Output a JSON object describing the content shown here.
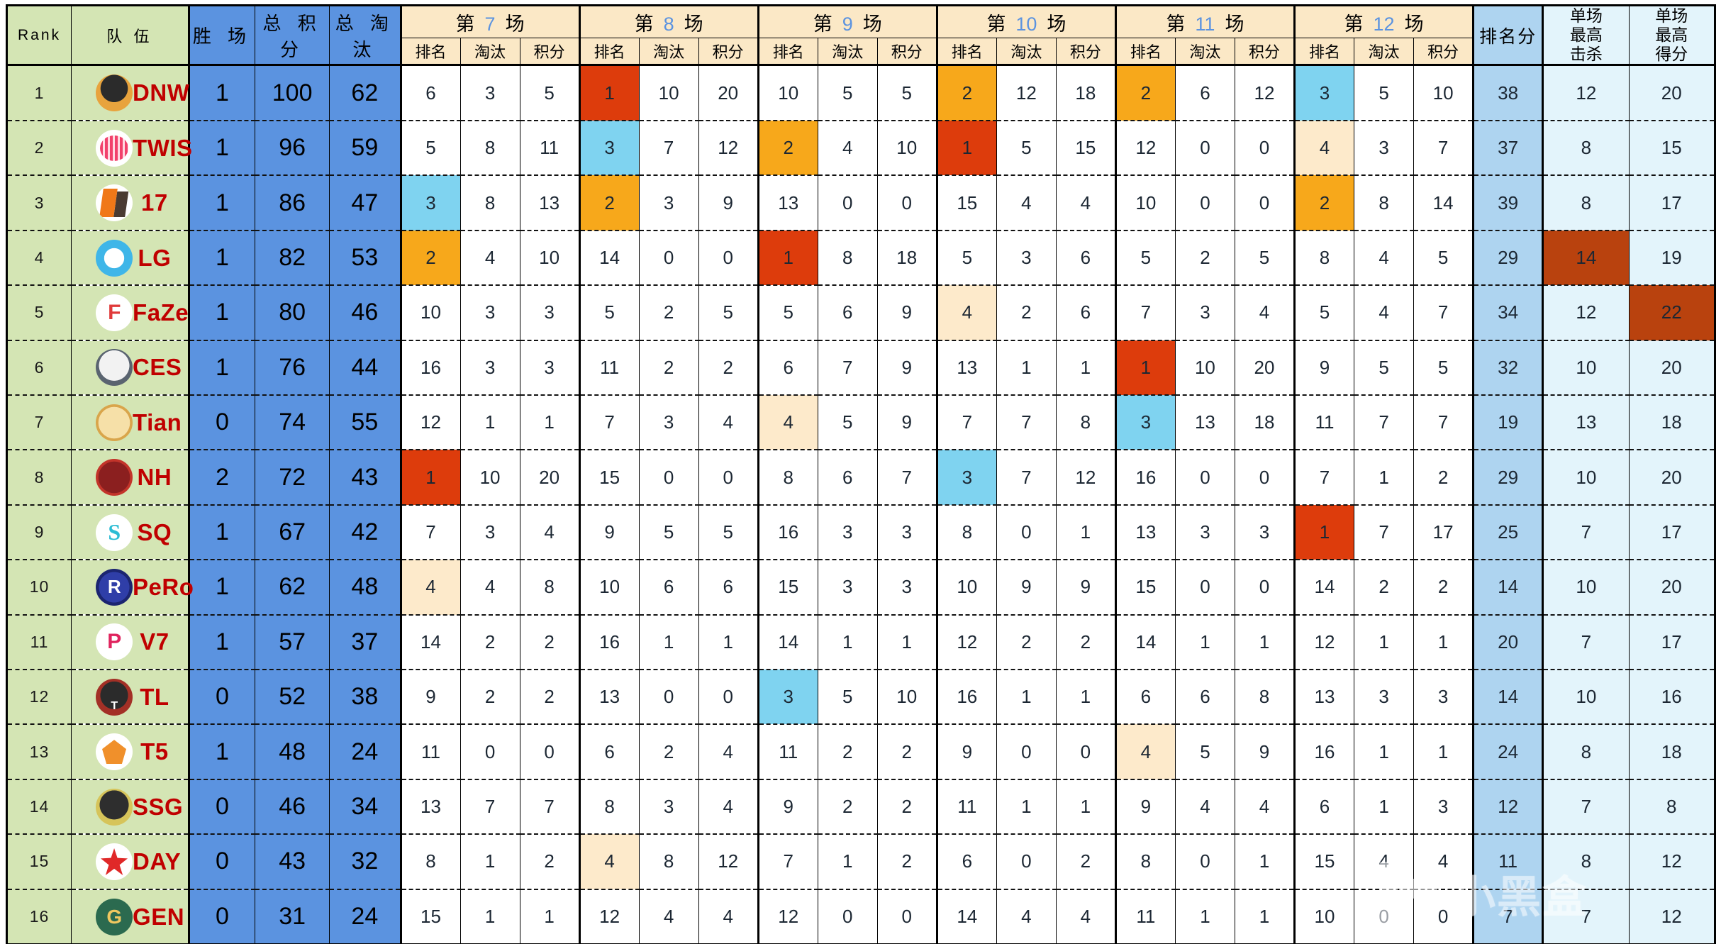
{
  "header": {
    "rank_label": "Rank",
    "team_label": "队 伍",
    "wins_label": "胜 场",
    "total_points_label": "总 积 分",
    "total_elims_label": "总 淘 汰",
    "match_prefix": "第",
    "match_suffix": "场",
    "match_numbers": [
      "7",
      "8",
      "9",
      "10",
      "11",
      "12"
    ],
    "sub_labels": {
      "place": "排名",
      "elims": "淘汰",
      "points": "积分"
    },
    "rank_points_label": "排名分",
    "best_kills_label": "单场\n最高\n击杀",
    "best_kills_lines": [
      "单场",
      "最高",
      "击杀"
    ],
    "best_score_label": "单场\n最高\n得分",
    "best_score_lines": [
      "单场",
      "最高",
      "得分"
    ]
  },
  "colors": {
    "header_green": "#d4e5b4",
    "header_blue": "#5b93e0",
    "header_cream": "#fbe8c6",
    "rank_points_blue": "#aed4f0",
    "best_light_blue": "#e3f4fb",
    "place1_red": "#dd3c0c",
    "place2_orange": "#f7a81b",
    "place3_cyan": "#7fd3f0",
    "place4_cream": "#fdeacb",
    "highlight_dark_red": "#b9420e",
    "team_name_red": "#c00000",
    "match_number_blue": "#5b93e0"
  },
  "watermark": {
    "text": "小黑盒"
  },
  "rows": [
    {
      "rank": "1",
      "team": "DNW",
      "logo": "lg-dnw",
      "wins": "1",
      "total_points": "100",
      "total_elims": "62",
      "matches": [
        {
          "place": "6",
          "elims": "3",
          "points": "5"
        },
        {
          "place": "1",
          "elims": "10",
          "points": "20",
          "hl": "hl-1"
        },
        {
          "place": "10",
          "elims": "5",
          "points": "5"
        },
        {
          "place": "2",
          "elims": "12",
          "points": "18",
          "hl": "hl-2"
        },
        {
          "place": "2",
          "elims": "6",
          "points": "12",
          "hl": "hl-2"
        },
        {
          "place": "3",
          "elims": "5",
          "points": "10",
          "hl": "hl-3"
        }
      ],
      "rank_points": "38",
      "best_kills": "12",
      "best_score": "20"
    },
    {
      "rank": "2",
      "team": "TWIS",
      "logo": "lg-twis",
      "wins": "1",
      "total_points": "96",
      "total_elims": "59",
      "matches": [
        {
          "place": "5",
          "elims": "8",
          "points": "11"
        },
        {
          "place": "3",
          "elims": "7",
          "points": "12",
          "hl": "hl-3"
        },
        {
          "place": "2",
          "elims": "4",
          "points": "10",
          "hl": "hl-2"
        },
        {
          "place": "1",
          "elims": "5",
          "points": "15",
          "hl": "hl-1"
        },
        {
          "place": "12",
          "elims": "0",
          "points": "0"
        },
        {
          "place": "4",
          "elims": "3",
          "points": "7",
          "hl": "hl-4"
        }
      ],
      "rank_points": "37",
      "best_kills": "8",
      "best_score": "15"
    },
    {
      "rank": "3",
      "team": "17",
      "logo": "lg-17",
      "wins": "1",
      "total_points": "86",
      "total_elims": "47",
      "matches": [
        {
          "place": "3",
          "elims": "8",
          "points": "13",
          "hl": "hl-3"
        },
        {
          "place": "2",
          "elims": "3",
          "points": "9",
          "hl": "hl-2"
        },
        {
          "place": "13",
          "elims": "0",
          "points": "0"
        },
        {
          "place": "15",
          "elims": "4",
          "points": "4"
        },
        {
          "place": "10",
          "elims": "0",
          "points": "0"
        },
        {
          "place": "2",
          "elims": "8",
          "points": "14",
          "hl": "hl-2"
        }
      ],
      "rank_points": "39",
      "best_kills": "8",
      "best_score": "17"
    },
    {
      "rank": "4",
      "team": "LG",
      "logo": "lg-lg",
      "wins": "1",
      "total_points": "82",
      "total_elims": "53",
      "matches": [
        {
          "place": "2",
          "elims": "4",
          "points": "10",
          "hl": "hl-2"
        },
        {
          "place": "14",
          "elims": "0",
          "points": "0"
        },
        {
          "place": "1",
          "elims": "8",
          "points": "18",
          "hl": "hl-1"
        },
        {
          "place": "5",
          "elims": "3",
          "points": "6"
        },
        {
          "place": "5",
          "elims": "2",
          "points": "5"
        },
        {
          "place": "8",
          "elims": "4",
          "points": "5"
        }
      ],
      "rank_points": "29",
      "best_kills": "14",
      "best_score": "19",
      "best_kills_hl": "hl-dark"
    },
    {
      "rank": "5",
      "team": "FaZe",
      "logo": "lg-faze",
      "wins": "1",
      "total_points": "80",
      "total_elims": "46",
      "matches": [
        {
          "place": "10",
          "elims": "3",
          "points": "3"
        },
        {
          "place": "5",
          "elims": "2",
          "points": "5"
        },
        {
          "place": "5",
          "elims": "6",
          "points": "9"
        },
        {
          "place": "4",
          "elims": "2",
          "points": "6",
          "hl": "hl-4"
        },
        {
          "place": "7",
          "elims": "3",
          "points": "4"
        },
        {
          "place": "5",
          "elims": "4",
          "points": "7"
        }
      ],
      "rank_points": "34",
      "best_kills": "12",
      "best_score": "22",
      "best_score_hl": "hl-dark"
    },
    {
      "rank": "6",
      "team": "CES",
      "logo": "lg-ces",
      "wins": "1",
      "total_points": "76",
      "total_elims": "44",
      "matches": [
        {
          "place": "16",
          "elims": "3",
          "points": "3"
        },
        {
          "place": "11",
          "elims": "2",
          "points": "2"
        },
        {
          "place": "6",
          "elims": "7",
          "points": "9"
        },
        {
          "place": "13",
          "elims": "1",
          "points": "1"
        },
        {
          "place": "1",
          "elims": "10",
          "points": "20",
          "hl": "hl-1"
        },
        {
          "place": "9",
          "elims": "5",
          "points": "5"
        }
      ],
      "rank_points": "32",
      "best_kills": "10",
      "best_score": "20"
    },
    {
      "rank": "7",
      "team": "Tian",
      "logo": "lg-tian",
      "wins": "0",
      "total_points": "74",
      "total_elims": "55",
      "matches": [
        {
          "place": "12",
          "elims": "1",
          "points": "1"
        },
        {
          "place": "7",
          "elims": "3",
          "points": "4"
        },
        {
          "place": "4",
          "elims": "5",
          "points": "9",
          "hl": "hl-4"
        },
        {
          "place": "7",
          "elims": "7",
          "points": "8"
        },
        {
          "place": "3",
          "elims": "13",
          "points": "18",
          "hl": "hl-3"
        },
        {
          "place": "11",
          "elims": "7",
          "points": "7"
        }
      ],
      "rank_points": "19",
      "best_kills": "13",
      "best_score": "18"
    },
    {
      "rank": "8",
      "team": "NH",
      "logo": "lg-nh",
      "wins": "2",
      "total_points": "72",
      "total_elims": "43",
      "matches": [
        {
          "place": "1",
          "elims": "10",
          "points": "20",
          "hl": "hl-1"
        },
        {
          "place": "15",
          "elims": "0",
          "points": "0"
        },
        {
          "place": "8",
          "elims": "6",
          "points": "7"
        },
        {
          "place": "3",
          "elims": "7",
          "points": "12",
          "hl": "hl-3"
        },
        {
          "place": "16",
          "elims": "0",
          "points": "0"
        },
        {
          "place": "7",
          "elims": "1",
          "points": "2"
        }
      ],
      "rank_points": "29",
      "best_kills": "10",
      "best_score": "20"
    },
    {
      "rank": "9",
      "team": "SQ",
      "logo": "lg-sq",
      "wins": "1",
      "total_points": "67",
      "total_elims": "42",
      "matches": [
        {
          "place": "7",
          "elims": "3",
          "points": "4"
        },
        {
          "place": "9",
          "elims": "5",
          "points": "5"
        },
        {
          "place": "16",
          "elims": "3",
          "points": "3"
        },
        {
          "place": "8",
          "elims": "0",
          "points": "1"
        },
        {
          "place": "13",
          "elims": "3",
          "points": "3"
        },
        {
          "place": "1",
          "elims": "7",
          "points": "17",
          "hl": "hl-1"
        }
      ],
      "rank_points": "25",
      "best_kills": "7",
      "best_score": "17"
    },
    {
      "rank": "10",
      "team": "PeRo",
      "logo": "lg-pero",
      "wins": "1",
      "total_points": "62",
      "total_elims": "48",
      "matches": [
        {
          "place": "4",
          "elims": "4",
          "points": "8",
          "hl": "hl-4"
        },
        {
          "place": "10",
          "elims": "6",
          "points": "6"
        },
        {
          "place": "15",
          "elims": "3",
          "points": "3"
        },
        {
          "place": "10",
          "elims": "9",
          "points": "9"
        },
        {
          "place": "15",
          "elims": "0",
          "points": "0"
        },
        {
          "place": "14",
          "elims": "2",
          "points": "2"
        }
      ],
      "rank_points": "14",
      "best_kills": "10",
      "best_score": "20"
    },
    {
      "rank": "11",
      "team": "V7",
      "logo": "lg-v7",
      "wins": "1",
      "total_points": "57",
      "total_elims": "37",
      "matches": [
        {
          "place": "14",
          "elims": "2",
          "points": "2"
        },
        {
          "place": "16",
          "elims": "1",
          "points": "1"
        },
        {
          "place": "14",
          "elims": "1",
          "points": "1"
        },
        {
          "place": "12",
          "elims": "2",
          "points": "2"
        },
        {
          "place": "14",
          "elims": "1",
          "points": "1"
        },
        {
          "place": "12",
          "elims": "1",
          "points": "1"
        }
      ],
      "rank_points": "20",
      "best_kills": "7",
      "best_score": "17"
    },
    {
      "rank": "12",
      "team": "TL",
      "logo": "lg-tl",
      "wins": "0",
      "total_points": "52",
      "total_elims": "38",
      "matches": [
        {
          "place": "9",
          "elims": "2",
          "points": "2"
        },
        {
          "place": "13",
          "elims": "0",
          "points": "0"
        },
        {
          "place": "3",
          "elims": "5",
          "points": "10",
          "hl": "hl-3"
        },
        {
          "place": "16",
          "elims": "1",
          "points": "1"
        },
        {
          "place": "6",
          "elims": "6",
          "points": "8"
        },
        {
          "place": "13",
          "elims": "3",
          "points": "3"
        }
      ],
      "rank_points": "14",
      "best_kills": "10",
      "best_score": "16"
    },
    {
      "rank": "13",
      "team": "T5",
      "logo": "lg-t5",
      "wins": "1",
      "total_points": "48",
      "total_elims": "24",
      "matches": [
        {
          "place": "11",
          "elims": "0",
          "points": "0"
        },
        {
          "place": "6",
          "elims": "2",
          "points": "4"
        },
        {
          "place": "11",
          "elims": "2",
          "points": "2"
        },
        {
          "place": "9",
          "elims": "0",
          "points": "0"
        },
        {
          "place": "4",
          "elims": "5",
          "points": "9",
          "hl": "hl-4"
        },
        {
          "place": "16",
          "elims": "1",
          "points": "1"
        }
      ],
      "rank_points": "24",
      "best_kills": "8",
      "best_score": "18"
    },
    {
      "rank": "14",
      "team": "SSG",
      "logo": "lg-ssg",
      "wins": "0",
      "total_points": "46",
      "total_elims": "34",
      "matches": [
        {
          "place": "13",
          "elims": "7",
          "points": "7"
        },
        {
          "place": "8",
          "elims": "3",
          "points": "4"
        },
        {
          "place": "9",
          "elims": "2",
          "points": "2"
        },
        {
          "place": "11",
          "elims": "1",
          "points": "1"
        },
        {
          "place": "9",
          "elims": "4",
          "points": "4"
        },
        {
          "place": "6",
          "elims": "1",
          "points": "3"
        }
      ],
      "rank_points": "12",
      "best_kills": "7",
      "best_score": "8"
    },
    {
      "rank": "15",
      "team": "DAY",
      "logo": "lg-day",
      "wins": "0",
      "total_points": "43",
      "total_elims": "32",
      "matches": [
        {
          "place": "8",
          "elims": "1",
          "points": "2"
        },
        {
          "place": "4",
          "elims": "8",
          "points": "12",
          "hl": "hl-4"
        },
        {
          "place": "7",
          "elims": "1",
          "points": "2"
        },
        {
          "place": "6",
          "elims": "0",
          "points": "2"
        },
        {
          "place": "8",
          "elims": "0",
          "points": "1"
        },
        {
          "place": "15",
          "elims": "4",
          "points": "4"
        }
      ],
      "rank_points": "11",
      "best_kills": "8",
      "best_score": "12"
    },
    {
      "rank": "16",
      "team": "GEN",
      "logo": "lg-gen",
      "wins": "0",
      "total_points": "31",
      "total_elims": "24",
      "matches": [
        {
          "place": "15",
          "elims": "1",
          "points": "1"
        },
        {
          "place": "12",
          "elims": "4",
          "points": "4"
        },
        {
          "place": "12",
          "elims": "0",
          "points": "0"
        },
        {
          "place": "14",
          "elims": "4",
          "points": "4"
        },
        {
          "place": "11",
          "elims": "1",
          "points": "1"
        },
        {
          "place": "10",
          "elims": "0",
          "points": "0"
        }
      ],
      "rank_points": "7",
      "best_kills": "7",
      "best_score": "12"
    }
  ]
}
